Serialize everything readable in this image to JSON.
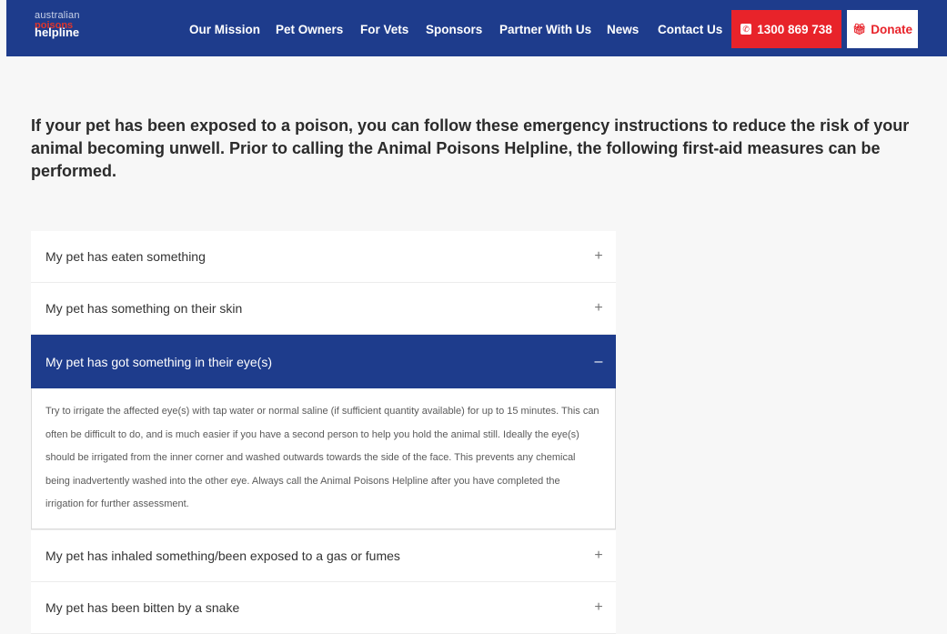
{
  "header": {
    "logo": {
      "line1": "australian",
      "line2": "poisons",
      "line3": "helpline"
    },
    "nav": [
      "Our Mission",
      "Pet Owners",
      "For Vets",
      "Sponsors",
      "Partner With Us",
      "News",
      "Contact Us"
    ],
    "phone_label": "1300 869 738",
    "donate_label": "Donate"
  },
  "intro_text": "If your pet has been exposed to a poison, you can follow these emergency instructions to reduce the risk of your animal becoming unwell. Prior to calling the Animal Poisons Helpline, the following first-aid measures can be performed.",
  "accordion": [
    {
      "title": "My pet has eaten something",
      "sign": "+"
    },
    {
      "title": "My pet has something on their skin",
      "sign": "+"
    },
    {
      "title": "My pet has got something in their eye(s)",
      "sign": "–",
      "body": "Try to irrigate the affected eye(s) with tap water or normal saline (if sufficient quantity available) for up to 15 minutes. This can often be difficult to do, and is much easier if you have a second person to help you hold the animal still. Ideally the eye(s) should be irrigated from the inner corner and washed outwards towards the side of the face. This prevents any chemical being inadvertently washed into the other eye. Always call the Animal Poisons Helpline after you have completed the irrigation for further assessment."
    },
    {
      "title": "My pet has inhaled something/been exposed to a gas or fumes",
      "sign": "+"
    },
    {
      "title": "My pet has been bitten by a snake",
      "sign": "+"
    }
  ],
  "colors": {
    "navy": "#1e3c8c",
    "red": "#e8232a"
  },
  "icons": {
    "phone": "phone-icon",
    "donate": "gift-icon",
    "expand": "plus-icon",
    "collapse": "minus-icon"
  }
}
